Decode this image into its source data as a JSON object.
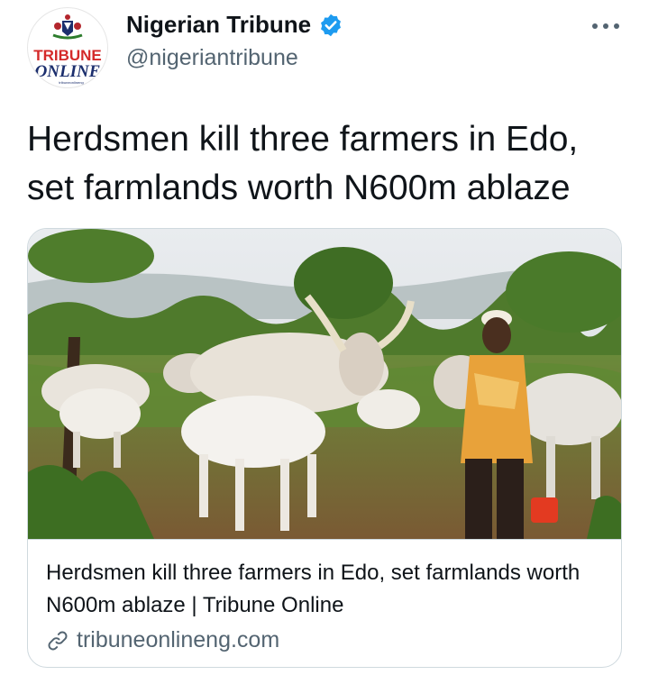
{
  "account": {
    "display_name": "Nigerian Tribune",
    "handle": "@nigeriantribune",
    "verified": true,
    "avatar_logo_text": [
      "TRIBUNE",
      "ONLINE",
      "tribuneonlineng"
    ]
  },
  "tweet": {
    "text_line1": "Herdsmen kill three farmers in Edo,",
    "text_line2": "set farmlands worth N600m ablaze"
  },
  "card": {
    "image_icon": "cattle-herdsman-photo",
    "title": "Herdsmen kill three farmers in Edo, set farmlands worth N600m ablaze | Tribune Online",
    "domain": "tribuneonlineng.com"
  },
  "colors": {
    "verified_blue": "#1d9bf0",
    "secondary_text": "#536471",
    "border": "#cfd9de",
    "logo_red": "#d42a2a",
    "logo_navy": "#1c2f6e"
  }
}
